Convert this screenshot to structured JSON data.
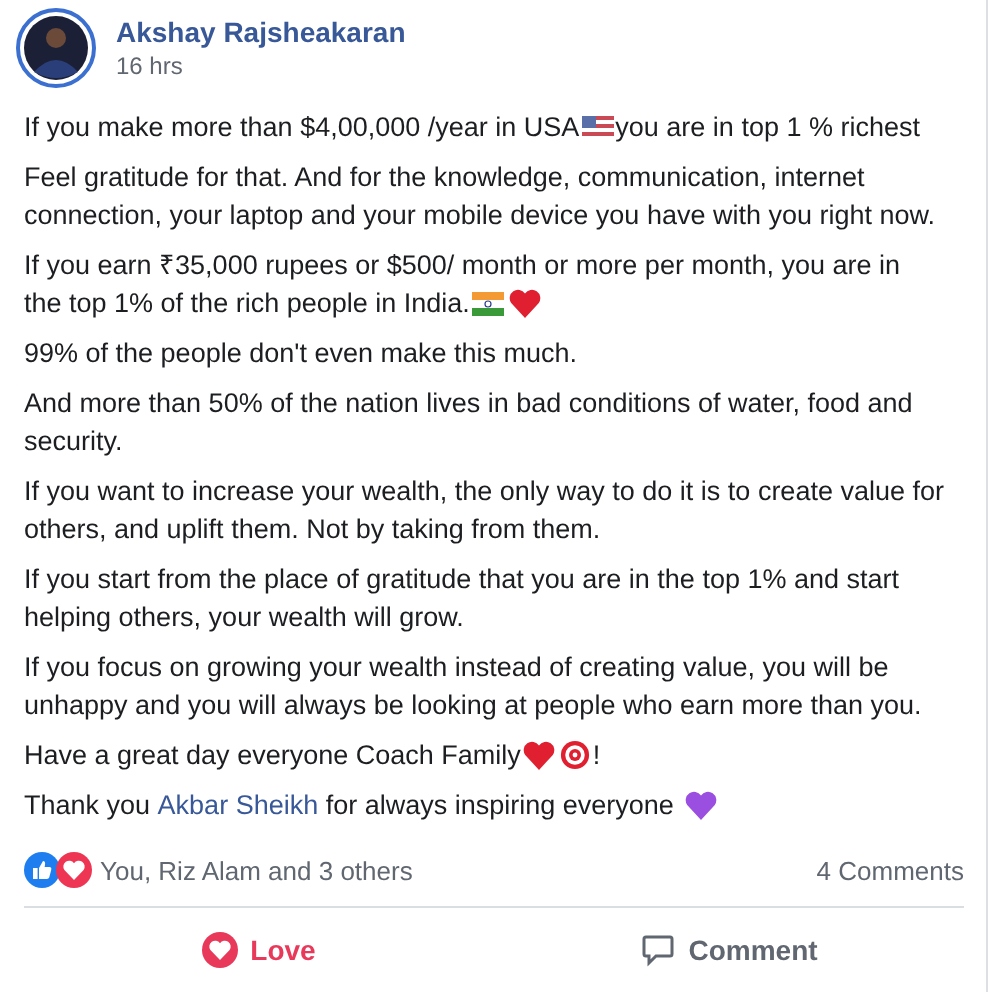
{
  "post": {
    "author": "Akshay Rajsheakaran",
    "time": "16 hrs",
    "paragraphs": [
      [
        {
          "kind": "text",
          "text": "If you make more than $4,00,000 /year in USA"
        },
        {
          "kind": "us-flag"
        },
        {
          "kind": "text",
          "text": "you are in top 1 % richest"
        }
      ],
      [
        {
          "kind": "text",
          "text": "Feel gratitude for that. And for the knowledge, communication, internet connection, your laptop and your mobile device you have with you right now."
        }
      ],
      [
        {
          "kind": "text",
          "text": "If you earn ₹35,000 rupees or $500/ month or more per month, you are in"
        },
        {
          "kind": "text",
          "text": "the top 1% of the rich people in India."
        },
        {
          "kind": "india-flag"
        },
        {
          "kind": "heart"
        }
      ],
      [
        {
          "kind": "text",
          "text": "99% of the people don't even make this much."
        }
      ],
      [
        {
          "kind": "text",
          "text": "And more than 50% of the nation lives in bad conditions of water, food and security."
        }
      ],
      [
        {
          "kind": "text",
          "text": "If you want to increase your wealth, the only way to do it is to create value for others, and uplift them. Not by taking from them."
        }
      ],
      [
        {
          "kind": "text",
          "text": "If you start from the place of gratitude that you are in the top 1% and start helping others, your wealth will grow."
        }
      ],
      [
        {
          "kind": "text",
          "text": "If you focus on growing your wealth instead of creating value, you will be unhappy and you will always be looking at people who earn more than you."
        }
      ],
      [
        {
          "kind": "text",
          "text": "Have a great day everyone Coach Family"
        },
        {
          "kind": "heart"
        },
        {
          "kind": "target"
        },
        {
          "kind": "text",
          "text": "!"
        }
      ],
      [
        {
          "kind": "text",
          "text": "Thank you "
        },
        {
          "kind": "link",
          "text": "Akbar Sheikh"
        },
        {
          "kind": "text",
          "text": " for always inspiring everyone "
        },
        {
          "kind": "purple-heart"
        }
      ]
    ],
    "reactions": {
      "text": "You, Riz Alam and 3 others",
      "comments": "4 Comments"
    },
    "actions": [
      {
        "label": "Love",
        "kind": "love",
        "selected": true
      },
      {
        "label": "Comment",
        "kind": "comment",
        "selected": false
      }
    ]
  }
}
